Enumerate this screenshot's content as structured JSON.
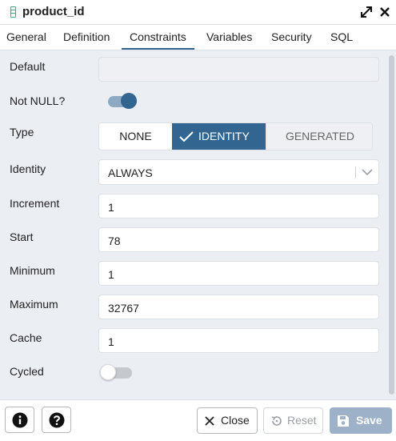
{
  "dialog": {
    "title": "product_id",
    "icon": "column-icon"
  },
  "tabs": [
    {
      "label": "General"
    },
    {
      "label": "Definition"
    },
    {
      "label": "Constraints",
      "active": true
    },
    {
      "label": "Variables"
    },
    {
      "label": "Security"
    },
    {
      "label": "SQL"
    }
  ],
  "form": {
    "default": {
      "label": "Default",
      "value": ""
    },
    "not_null": {
      "label": "Not NULL?",
      "checked": true
    },
    "type": {
      "label": "Type",
      "options": [
        "NONE",
        "IDENTITY",
        "GENERATED"
      ],
      "selected": "IDENTITY"
    },
    "identity": {
      "label": "Identity",
      "value": "ALWAYS"
    },
    "increment": {
      "label": "Increment",
      "value": "1"
    },
    "start": {
      "label": "Start",
      "value": "78"
    },
    "minimum": {
      "label": "Minimum",
      "value": "1"
    },
    "maximum": {
      "label": "Maximum",
      "value": "32767"
    },
    "cache": {
      "label": "Cache",
      "value": "1"
    },
    "cycled": {
      "label": "Cycled",
      "checked": false
    }
  },
  "footer": {
    "info_icon": "info-icon",
    "help_icon": "help-icon",
    "close_label": "Close",
    "reset_label": "Reset",
    "save_label": "Save"
  },
  "colors": {
    "accent": "#326690",
    "background": "#ebeef3",
    "save_disabled": "#9db2c8",
    "column_icon": "#3cab7a"
  }
}
